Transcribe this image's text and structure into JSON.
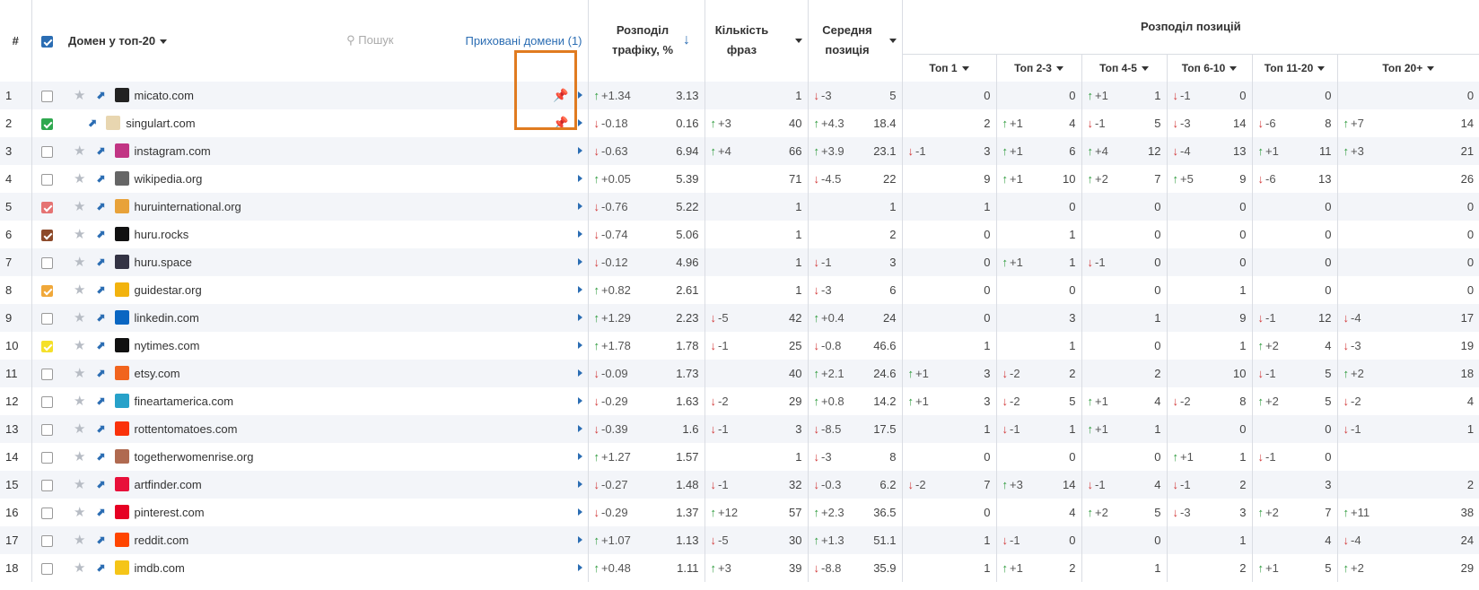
{
  "header": {
    "hash": "#",
    "domain_col": "Домен у топ-20",
    "search_placeholder": "Пошук",
    "hidden_domains": "Приховані домени (1)",
    "traffic": "Розподіл трафіку, %",
    "phrases": "Кількість фраз",
    "avg_pos": "Середня позиція",
    "pos_dist": "Розподіл позицій",
    "top_cols": [
      "Топ 1",
      "Топ 2-3",
      "Топ 4-5",
      "Топ 6-10",
      "Топ 11-20",
      "Топ 20+"
    ]
  },
  "colors": {
    "up": "#2b9a3a",
    "down": "#d23a3a",
    "link": "#2b6db3",
    "highlight": "#e07b20"
  },
  "rows": [
    {
      "n": "1",
      "check": "",
      "domain": "micato.com",
      "fav": "#222",
      "pin": true,
      "tr_d": "+1.34",
      "tr_dir": "up",
      "tr": "3.13",
      "ph_d": "",
      "ph_dir": "",
      "ph": "1",
      "ap_d": "-3",
      "ap_dir": "dn",
      "ap": "5",
      "t": [
        [
          "",
          "",
          "0"
        ],
        [
          "",
          "",
          "0"
        ],
        [
          "up",
          "+1",
          "1"
        ],
        [
          "dn",
          "-1",
          "0"
        ],
        [
          "",
          "",
          "0"
        ],
        [
          "",
          "",
          "0"
        ]
      ]
    },
    {
      "n": "2",
      "check": "#2fa84f",
      "domain": "singulart.com",
      "fav": "#e8d6b0",
      "pin": true,
      "tr_d": "-0.18",
      "tr_dir": "dn",
      "tr": "0.16",
      "ph_d": "+3",
      "ph_dir": "up",
      "ph": "40",
      "ap_d": "+4.3",
      "ap_dir": "up",
      "ap": "18.4",
      "t": [
        [
          "",
          "",
          "2"
        ],
        [
          "up",
          "+1",
          "4"
        ],
        [
          "dn",
          "-1",
          "5"
        ],
        [
          "dn",
          "-3",
          "14"
        ],
        [
          "dn",
          "-6",
          "8"
        ],
        [
          "up",
          "+7",
          "14"
        ]
      ]
    },
    {
      "n": "3",
      "check": "",
      "domain": "instagram.com",
      "fav": "#c13584",
      "pin": false,
      "tr_d": "-0.63",
      "tr_dir": "dn",
      "tr": "6.94",
      "ph_d": "+4",
      "ph_dir": "up",
      "ph": "66",
      "ap_d": "+3.9",
      "ap_dir": "up",
      "ap": "23.1",
      "t": [
        [
          "dn",
          "-1",
          "3"
        ],
        [
          "up",
          "+1",
          "6"
        ],
        [
          "up",
          "+4",
          "12"
        ],
        [
          "dn",
          "-4",
          "13"
        ],
        [
          "up",
          "+1",
          "11"
        ],
        [
          "up",
          "+3",
          "21"
        ]
      ]
    },
    {
      "n": "4",
      "check": "",
      "domain": "wikipedia.org",
      "fav": "#666",
      "pin": false,
      "tr_d": "+0.05",
      "tr_dir": "up",
      "tr": "5.39",
      "ph_d": "",
      "ph_dir": "",
      "ph": "71",
      "ap_d": "-4.5",
      "ap_dir": "dn",
      "ap": "22",
      "t": [
        [
          "",
          "",
          "9"
        ],
        [
          "up",
          "+1",
          "10"
        ],
        [
          "up",
          "+2",
          "7"
        ],
        [
          "up",
          "+5",
          "9"
        ],
        [
          "dn",
          "-6",
          "13"
        ],
        [
          "",
          "",
          "26"
        ]
      ]
    },
    {
      "n": "5",
      "check": "#e57373",
      "domain": "huruinternational.org",
      "fav": "#e8a23a",
      "pin": false,
      "tr_d": "-0.76",
      "tr_dir": "dn",
      "tr": "5.22",
      "ph_d": "",
      "ph_dir": "",
      "ph": "1",
      "ap_d": "",
      "ap_dir": "",
      "ap": "1",
      "t": [
        [
          "",
          "",
          "1"
        ],
        [
          "",
          "",
          "0"
        ],
        [
          "",
          "",
          "0"
        ],
        [
          "",
          "",
          "0"
        ],
        [
          "",
          "",
          "0"
        ],
        [
          "",
          "",
          "0"
        ]
      ]
    },
    {
      "n": "6",
      "check": "#8d4a2a",
      "domain": "huru.rocks",
      "fav": "#111",
      "pin": false,
      "tr_d": "-0.74",
      "tr_dir": "dn",
      "tr": "5.06",
      "ph_d": "",
      "ph_dir": "",
      "ph": "1",
      "ap_d": "",
      "ap_dir": "",
      "ap": "2",
      "t": [
        [
          "",
          "",
          "0"
        ],
        [
          "",
          "",
          "1"
        ],
        [
          "",
          "",
          "0"
        ],
        [
          "",
          "",
          "0"
        ],
        [
          "",
          "",
          "0"
        ],
        [
          "",
          "",
          "0"
        ]
      ]
    },
    {
      "n": "7",
      "check": "",
      "domain": "huru.space",
      "fav": "#334",
      "pin": false,
      "tr_d": "-0.12",
      "tr_dir": "dn",
      "tr": "4.96",
      "ph_d": "",
      "ph_dir": "",
      "ph": "1",
      "ap_d": "-1",
      "ap_dir": "dn",
      "ap": "3",
      "t": [
        [
          "",
          "",
          "0"
        ],
        [
          "up",
          "+1",
          "1"
        ],
        [
          "dn",
          "-1",
          "0"
        ],
        [
          "",
          "",
          "0"
        ],
        [
          "",
          "",
          "0"
        ],
        [
          "",
          "",
          "0"
        ]
      ]
    },
    {
      "n": "8",
      "check": "#f0a83a",
      "domain": "guidestar.org",
      "fav": "#f2b30e",
      "pin": false,
      "tr_d": "+0.82",
      "tr_dir": "up",
      "tr": "2.61",
      "ph_d": "",
      "ph_dir": "",
      "ph": "1",
      "ap_d": "-3",
      "ap_dir": "dn",
      "ap": "6",
      "t": [
        [
          "",
          "",
          "0"
        ],
        [
          "",
          "",
          "0"
        ],
        [
          "",
          "",
          "0"
        ],
        [
          "",
          "",
          "1"
        ],
        [
          "",
          "",
          "0"
        ],
        [
          "",
          "",
          "0"
        ]
      ]
    },
    {
      "n": "9",
      "check": "",
      "domain": "linkedin.com",
      "fav": "#0a66c2",
      "pin": false,
      "tr_d": "+1.29",
      "tr_dir": "up",
      "tr": "2.23",
      "ph_d": "-5",
      "ph_dir": "dn",
      "ph": "42",
      "ap_d": "+0.4",
      "ap_dir": "up",
      "ap": "24",
      "t": [
        [
          "",
          "",
          "0"
        ],
        [
          "",
          "",
          "3"
        ],
        [
          "",
          "",
          "1"
        ],
        [
          "",
          "",
          "9"
        ],
        [
          "dn",
          "-1",
          "12"
        ],
        [
          "dn",
          "-4",
          "17"
        ]
      ]
    },
    {
      "n": "10",
      "check": "#f5e02a",
      "domain": "nytimes.com",
      "fav": "#111",
      "pin": false,
      "tr_d": "+1.78",
      "tr_dir": "up",
      "tr": "1.78",
      "ph_d": "-1",
      "ph_dir": "dn",
      "ph": "25",
      "ap_d": "-0.8",
      "ap_dir": "dn",
      "ap": "46.6",
      "t": [
        [
          "",
          "",
          "1"
        ],
        [
          "",
          "",
          "1"
        ],
        [
          "",
          "",
          "0"
        ],
        [
          "",
          "",
          "1"
        ],
        [
          "up",
          "+2",
          "4"
        ],
        [
          "dn",
          "-3",
          "19"
        ]
      ]
    },
    {
      "n": "11",
      "check": "",
      "domain": "etsy.com",
      "fav": "#f1641e",
      "pin": false,
      "tr_d": "-0.09",
      "tr_dir": "dn",
      "tr": "1.73",
      "ph_d": "",
      "ph_dir": "",
      "ph": "40",
      "ap_d": "+2.1",
      "ap_dir": "up",
      "ap": "24.6",
      "t": [
        [
          "up",
          "+1",
          "3"
        ],
        [
          "dn",
          "-2",
          "2"
        ],
        [
          "",
          "",
          "2"
        ],
        [
          "",
          "",
          "10"
        ],
        [
          "dn",
          "-1",
          "5"
        ],
        [
          "up",
          "+2",
          "18"
        ]
      ]
    },
    {
      "n": "12",
      "check": "",
      "domain": "fineartamerica.com",
      "fav": "#27a1c9",
      "pin": false,
      "tr_d": "-0.29",
      "tr_dir": "dn",
      "tr": "1.63",
      "ph_d": "-2",
      "ph_dir": "dn",
      "ph": "29",
      "ap_d": "+0.8",
      "ap_dir": "up",
      "ap": "14.2",
      "t": [
        [
          "up",
          "+1",
          "3"
        ],
        [
          "dn",
          "-2",
          "5"
        ],
        [
          "up",
          "+1",
          "4"
        ],
        [
          "dn",
          "-2",
          "8"
        ],
        [
          "up",
          "+2",
          "5"
        ],
        [
          "dn",
          "-2",
          "4"
        ]
      ]
    },
    {
      "n": "13",
      "check": "",
      "domain": "rottentomatoes.com",
      "fav": "#fa320a",
      "pin": false,
      "tr_d": "-0.39",
      "tr_dir": "dn",
      "tr": "1.6",
      "ph_d": "-1",
      "ph_dir": "dn",
      "ph": "3",
      "ap_d": "-8.5",
      "ap_dir": "dn",
      "ap": "17.5",
      "t": [
        [
          "",
          "",
          "1"
        ],
        [
          "dn",
          "-1",
          "1"
        ],
        [
          "up",
          "+1",
          "1"
        ],
        [
          "",
          "",
          "0"
        ],
        [
          "",
          "",
          "0"
        ],
        [
          "dn",
          "-1",
          "1"
        ]
      ]
    },
    {
      "n": "14",
      "check": "",
      "domain": "togetherwomenrise.org",
      "fav": "#b06a50",
      "pin": false,
      "tr_d": "+1.27",
      "tr_dir": "up",
      "tr": "1.57",
      "ph_d": "",
      "ph_dir": "",
      "ph": "1",
      "ap_d": "-3",
      "ap_dir": "dn",
      "ap": "8",
      "t": [
        [
          "",
          "",
          "0"
        ],
        [
          "",
          "",
          "0"
        ],
        [
          "",
          "",
          "0"
        ],
        [
          "up",
          "+1",
          "1"
        ],
        [
          "dn",
          "-1",
          "0"
        ],
        [
          "",
          "",
          ""
        ]
      ]
    },
    {
      "n": "15",
      "check": "",
      "domain": "artfinder.com",
      "fav": "#e8103a",
      "pin": false,
      "tr_d": "-0.27",
      "tr_dir": "dn",
      "tr": "1.48",
      "ph_d": "-1",
      "ph_dir": "dn",
      "ph": "32",
      "ap_d": "-0.3",
      "ap_dir": "dn",
      "ap": "6.2",
      "t": [
        [
          "dn",
          "-2",
          "7"
        ],
        [
          "up",
          "+3",
          "14"
        ],
        [
          "dn",
          "-1",
          "4"
        ],
        [
          "dn",
          "-1",
          "2"
        ],
        [
          "",
          "",
          "3"
        ],
        [
          "",
          "",
          "2"
        ]
      ]
    },
    {
      "n": "16",
      "check": "",
      "domain": "pinterest.com",
      "fav": "#e60023",
      "pin": false,
      "tr_d": "-0.29",
      "tr_dir": "dn",
      "tr": "1.37",
      "ph_d": "+12",
      "ph_dir": "up",
      "ph": "57",
      "ap_d": "+2.3",
      "ap_dir": "up",
      "ap": "36.5",
      "t": [
        [
          "",
          "",
          "0"
        ],
        [
          "",
          "",
          "4"
        ],
        [
          "up",
          "+2",
          "5"
        ],
        [
          "dn",
          "-3",
          "3"
        ],
        [
          "up",
          "+2",
          "7"
        ],
        [
          "up",
          "+11",
          "38"
        ]
      ]
    },
    {
      "n": "17",
      "check": "",
      "domain": "reddit.com",
      "fav": "#ff4500",
      "pin": false,
      "tr_d": "+1.07",
      "tr_dir": "up",
      "tr": "1.13",
      "ph_d": "-5",
      "ph_dir": "dn",
      "ph": "30",
      "ap_d": "+1.3",
      "ap_dir": "up",
      "ap": "51.1",
      "t": [
        [
          "",
          "",
          "1"
        ],
        [
          "dn",
          "-1",
          "0"
        ],
        [
          "",
          "",
          "0"
        ],
        [
          "",
          "",
          "1"
        ],
        [
          "",
          "",
          "4"
        ],
        [
          "dn",
          "-4",
          "24"
        ]
      ]
    },
    {
      "n": "18",
      "check": "",
      "domain": "imdb.com",
      "fav": "#f5c518",
      "pin": false,
      "tr_d": "+0.48",
      "tr_dir": "up",
      "tr": "1.11",
      "ph_d": "+3",
      "ph_dir": "up",
      "ph": "39",
      "ap_d": "-8.8",
      "ap_dir": "dn",
      "ap": "35.9",
      "t": [
        [
          "",
          "",
          "1"
        ],
        [
          "up",
          "+1",
          "2"
        ],
        [
          "",
          "",
          "1"
        ],
        [
          "",
          "",
          "2"
        ],
        [
          "up",
          "+1",
          "5"
        ],
        [
          "up",
          "+2",
          "29"
        ]
      ]
    }
  ]
}
